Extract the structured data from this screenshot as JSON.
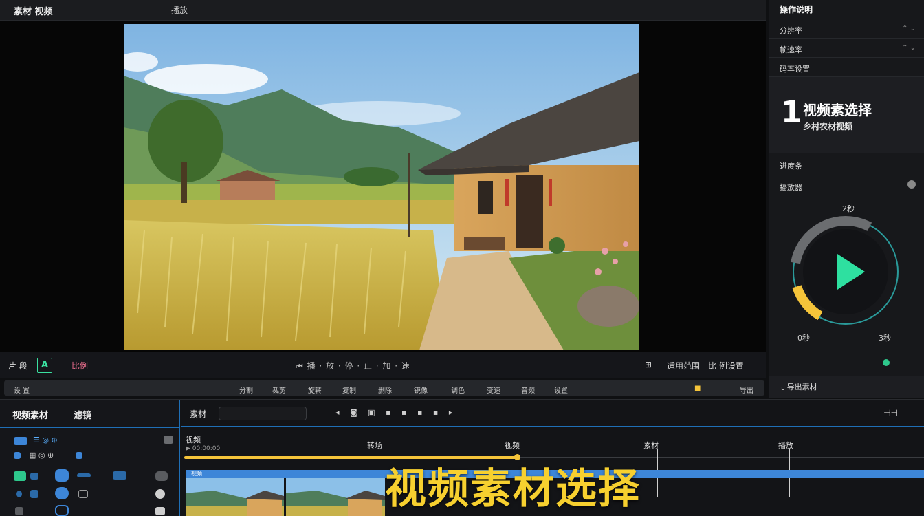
{
  "topbar": {
    "left_title": "素材 视频",
    "center_title": "播放"
  },
  "transport": {
    "left_label": "片 段",
    "record_glyph": "A",
    "color_label": "比例",
    "controls_text": "⏮ 播 · 放 · 停 · 止 · 加 · 速",
    "right_a": "⊞",
    "right_b": "适用范围",
    "right_c": "比 例设置"
  },
  "toolstrip": {
    "items": [
      "设 置",
      "分割",
      "裁剪",
      "旋转",
      "复制",
      "删除",
      "镜像",
      "调色",
      "变速",
      "音频",
      "设置"
    ],
    "right_label": "导出"
  },
  "right_panel": {
    "title": "操作说明",
    "rows": [
      {
        "key": "分辨率",
        "value": "⌃ ⌄"
      },
      {
        "key": "帧速率",
        "value": "⌃ ⌄"
      },
      {
        "key": "码率设置",
        "value": ""
      }
    ],
    "badge": {
      "number": "1",
      "heading": "视频素选择",
      "sub": "乡村农材视频"
    },
    "label_a": "进度条",
    "label_b": "播放器",
    "ring_top": "2秒",
    "ring_left": "0秒",
    "ring_right": "3秒",
    "ring_progress": 0.72,
    "bottom_label": "⌞ 导出素材"
  },
  "library": {
    "header_a": "视频素材",
    "header_b": "滤镜",
    "item_text_a": "☰ ◎ ⊕",
    "item_text_b": "▦ ◎ ⊕"
  },
  "timeline": {
    "header_label": "素材",
    "right_label": "⊣⊣",
    "icons": "◂ ◙ ▣ ▪ ▪ ▪ ▪ ▸",
    "track_name": "视频",
    "track_sub": "▶ 00:00:00",
    "markers": [
      "转场",
      "视频",
      "素材",
      "播放"
    ],
    "progress": 0.45,
    "clip_label": "视频",
    "caption": "视频素材选择"
  },
  "colors": {
    "accent": "#3ae0a0",
    "highlight": "#f7d02f",
    "timeline_blue": "#3d86d8",
    "ring_gray": "#6b6d70",
    "ring_yellow": "#f5c43a",
    "play_green": "#2ee0a0"
  }
}
